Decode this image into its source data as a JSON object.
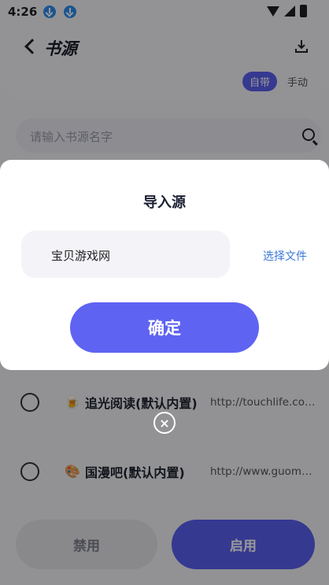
{
  "status_bar": {
    "time": "4:26"
  },
  "header": {
    "title": "书源",
    "toggle_on": "自带",
    "toggle_off": "手动"
  },
  "search": {
    "placeholder": "请输入书源名字"
  },
  "list": {
    "items": [
      {
        "emoji": "🍺",
        "name": "追光阅读(默认内置)",
        "url": "http://touchlife.coo..."
      },
      {
        "emoji": "🎨",
        "name": "国漫吧(默认内置)",
        "url": "http://www.guoman8...."
      }
    ]
  },
  "bottom": {
    "disable_label": "禁用",
    "enable_label": "启用"
  },
  "dialog": {
    "title": "导入源",
    "input_value": "宝贝游戏网",
    "choose_file": "选择文件",
    "confirm": "确定",
    "close": "×"
  },
  "colors": {
    "accent": "#5f63f2",
    "link": "#3c78d8",
    "download_badge": "#2f8cf0"
  }
}
